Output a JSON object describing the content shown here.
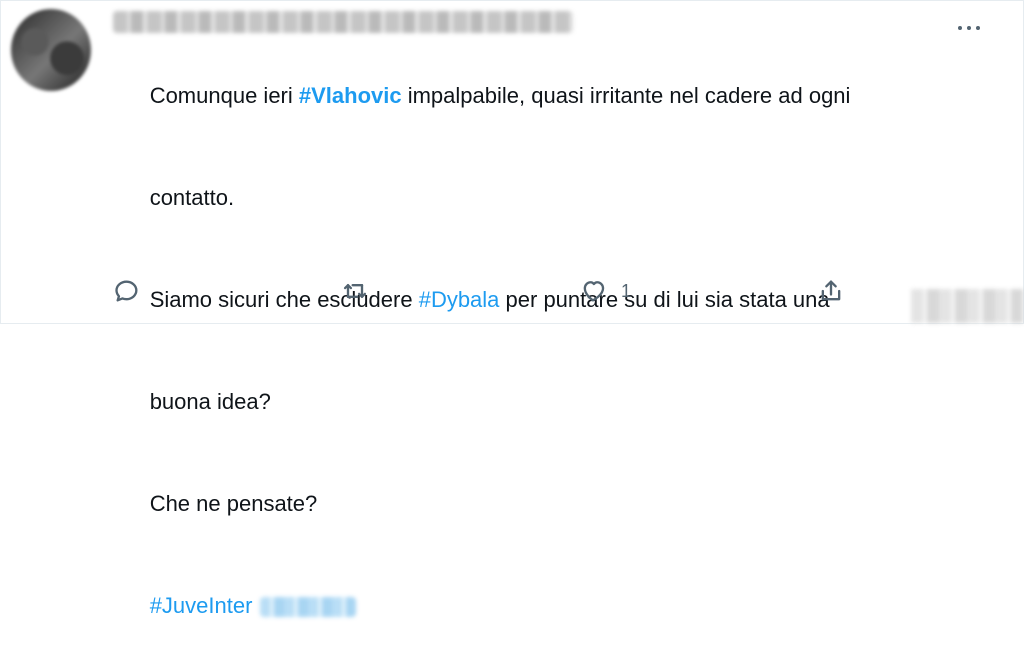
{
  "tweet": {
    "lines": [
      [
        "Comunque ieri ",
        "#Vlahovic",
        " impalpabile, quasi irritante nel cadere ad ogni"
      ],
      [
        "contatto."
      ],
      [
        "Siamo sicuri che escludere ",
        "#Dybala",
        " per puntare su di lui sia stata una"
      ],
      [
        "buona idea?"
      ],
      [
        "Che ne pensate?"
      ],
      [
        "#JuveInter"
      ]
    ],
    "actions": {
      "like_count": "1"
    },
    "icons": {
      "more": "more-icon",
      "reply": "reply-icon",
      "retweet": "retweet-icon",
      "like": "heart-icon",
      "share": "share-icon"
    },
    "colors": {
      "hashtag": "#1d9bf0",
      "text": "#0f1419",
      "icon": "#536471"
    }
  }
}
